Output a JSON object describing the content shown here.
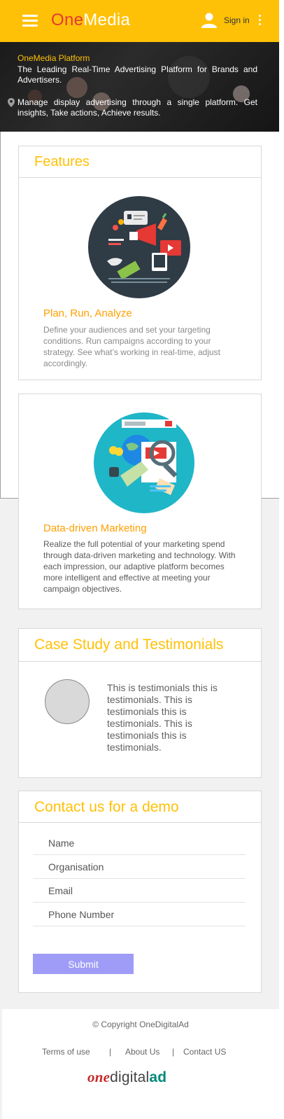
{
  "header": {
    "brand_one": "One",
    "brand_media": "Media",
    "signin_label": "Sign in"
  },
  "hero": {
    "title": "OneMedia Platform",
    "tagline": "The Leading Real-Time Advertising Platform for Brands and Advertisers.",
    "description": "Manage display advertising through a single platform. Get insights, Take actions, Achieve results."
  },
  "features": {
    "heading": "Features",
    "items": [
      {
        "title": "Plan, Run, Analyze",
        "description": "Define your audiences and set your targeting conditions. Run campaigns according to your strategy. See what’s working in real-time, adjust accordingly."
      },
      {
        "title": "Data-driven Marketing",
        "description": "Realize the full potential of your marketing spend through data-driven marketing and technology. With each impression, our adaptive platform becomes more intelligent and effective at meeting your campaign objectives."
      }
    ]
  },
  "testimonials": {
    "heading": "Case Study and Testimonials",
    "text": "This is testimonials this is testimonials. This is testimonials this is testimonials. This is testimonials this is testimonials."
  },
  "contact": {
    "heading": "Contact us for a demo",
    "fields": [
      {
        "placeholder": "Name"
      },
      {
        "placeholder": "Organisation"
      },
      {
        "placeholder": "Email"
      },
      {
        "placeholder": "Phone Number"
      }
    ],
    "submit_label": "Submit"
  },
  "footer": {
    "copyright": "© Copyright OneDigitalAd",
    "links": [
      "Terms of use",
      "About Us",
      "Contact US"
    ],
    "separator": "|",
    "logo_a": "one",
    "logo_b": "digital",
    "logo_c": "ad"
  },
  "colors": {
    "accent": "#ffc107",
    "brand_red": "#e53935",
    "submit": "#9e9cf7"
  }
}
